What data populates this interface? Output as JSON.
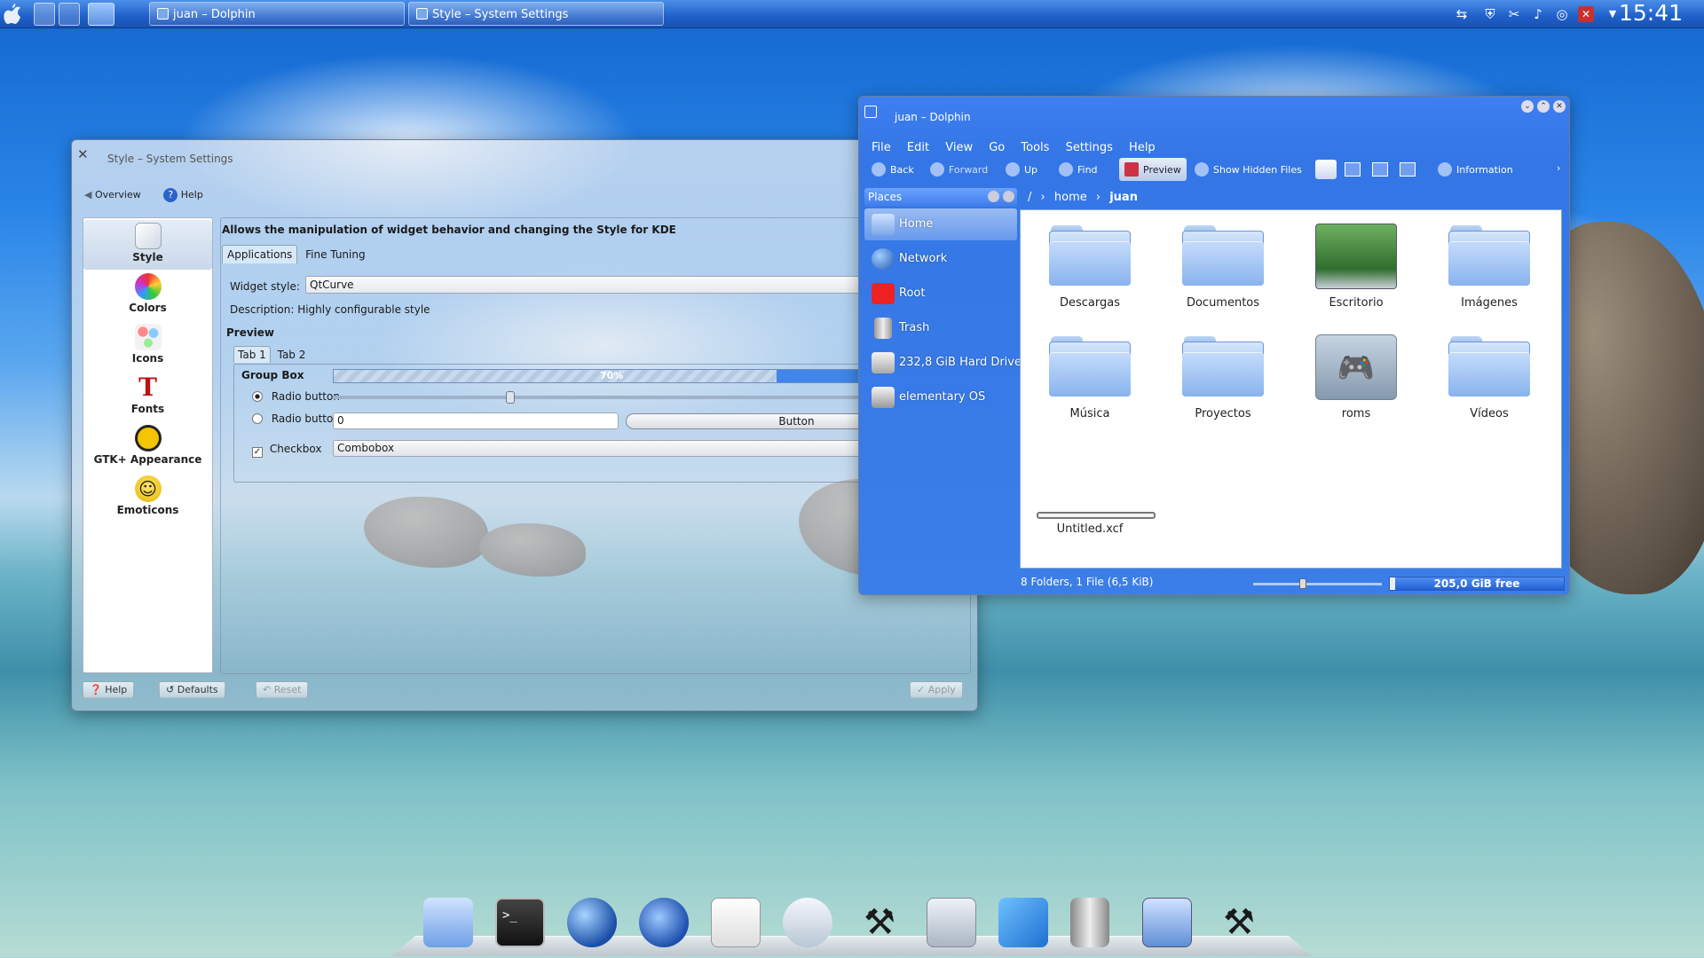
{
  "panel": {
    "tasks": [
      {
        "label": "juan – Dolphin"
      },
      {
        "label": "Style – System Settings"
      }
    ],
    "clock": "15:41"
  },
  "settings": {
    "title": "Style – System Settings",
    "toolbar": {
      "overview": "Overview",
      "help": "Help"
    },
    "categories": [
      "Style",
      "Colors",
      "Icons",
      "Fonts",
      "GTK+ Appearance",
      "Emoticons"
    ],
    "heading": "Allows the manipulation of widget behavior and changing the Style for KDE",
    "tabs": [
      "Applications",
      "Fine Tuning"
    ],
    "widget_style_label": "Widget style:",
    "widget_style_value": "QtCurve",
    "description": "Description: Highly configurable style",
    "preview_label": "Preview",
    "preview_tabs": [
      "Tab 1",
      "Tab 2"
    ],
    "group_box": "Group Box",
    "progress": "70%",
    "progress_value": 0.7,
    "radio1": "Radio button",
    "radio2": "Radio button",
    "spin_value": "0",
    "button_label": "Button",
    "checkbox": "Checkbox",
    "combobox": "Combobox",
    "footer": {
      "help": "Help",
      "defaults": "Defaults",
      "reset": "Reset",
      "apply": "Apply"
    }
  },
  "dolphin": {
    "title": "juan – Dolphin",
    "menu": [
      "File",
      "Edit",
      "View",
      "Go",
      "Tools",
      "Settings",
      "Help"
    ],
    "toolbar": {
      "back": "Back",
      "forward": "Forward",
      "up": "Up",
      "find": "Find",
      "preview": "Preview",
      "hidden": "Show Hidden Files",
      "information": "Information"
    },
    "places_title": "Places",
    "places": [
      "Home",
      "Network",
      "Root",
      "Trash",
      "232,8 GiB Hard Drive",
      "elementary OS"
    ],
    "breadcrumb": [
      "/",
      "home",
      "juan"
    ],
    "files": [
      "Descargas",
      "Documentos",
      "Escritorio",
      "Imágenes",
      "Música",
      "Proyectos",
      "roms",
      "Vídeos",
      "Untitled.xcf"
    ],
    "status": "8 Folders, 1 File (6,5 KiB)",
    "free": "205,0 GiB free",
    "free_fraction": 0.97
  }
}
